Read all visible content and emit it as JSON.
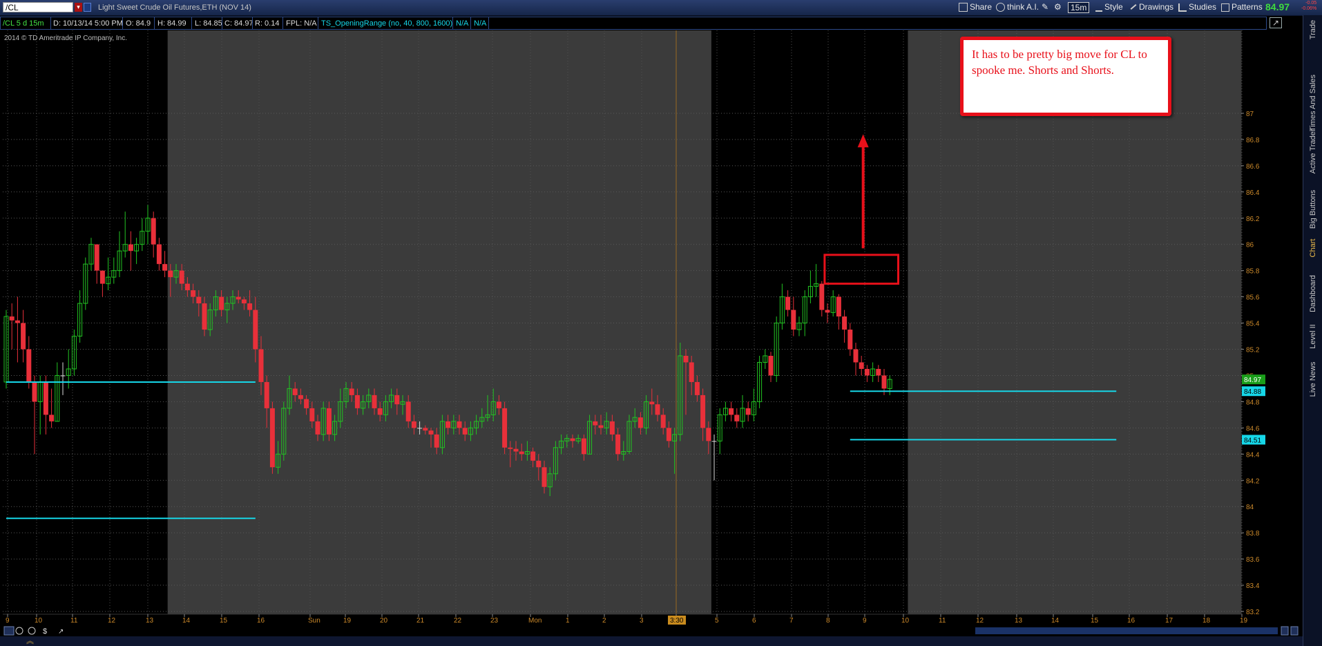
{
  "toolbar": {
    "symbol": "/CL",
    "description": "Light Sweet Crude Oil Futures,ETH (NOV 14)",
    "share_label": "Share",
    "think_ai_label": "think A.I.",
    "timeframe_label": "15m",
    "style_label": "Style",
    "drawings_label": "Drawings",
    "studies_label": "Studies",
    "patterns_label": "Patterns",
    "last_price": "84.97",
    "change_line1": "-0.05",
    "change_line2": "-0.06%"
  },
  "infobar": {
    "symbol_period": "/CL 5 d 15m",
    "date": "D: 10/13/14 5:00 PM",
    "open": "O: 84.9",
    "high": "H: 84.99",
    "low": "L: 84.85",
    "close": "C: 84.97",
    "range": "R: 0.14",
    "fpl": "FPL: N/A",
    "study": "TS_OpeningRange (no, 40, 800, 1600)",
    "na1": "N/A",
    "na2": "N/A"
  },
  "copyright": "2014 © TD Ameritrade IP Company, Inc.",
  "annotation": {
    "text": "It has to be pretty big move for CL to spooke me. Shorts and Shorts."
  },
  "right_panel_tabs": [
    "Trade",
    "Times And Sales",
    "Active Trader",
    "Big Buttons",
    "Chart",
    "Dashboard",
    "Level II",
    "Live News"
  ],
  "colors": {
    "up": "#22c422",
    "down": "#e8303a",
    "neutral": "#dddddd",
    "opening_range": "#16d7e8",
    "session_bg": "#3b3b3b",
    "axis_text": "#cd8a2a",
    "annotation": "#e8101a"
  },
  "chart_data": {
    "type": "candlestick",
    "ylim": [
      83.2,
      87.2
    ],
    "y_ticks": [
      "87",
      "86.8",
      "86.6",
      "86.4",
      "86.2",
      "86",
      "85.8",
      "85.6",
      "85.4",
      "85.2",
      "85",
      "84.8",
      "84.6",
      "84.4",
      "84.2",
      "84",
      "83.8",
      "83.6",
      "83.4",
      "83.2"
    ],
    "x_ticks": [
      "9",
      "10",
      "11",
      "12",
      "13",
      "14",
      "15",
      "16",
      "Sun",
      "19",
      "20",
      "21",
      "22",
      "23",
      "Mon",
      "1",
      "2",
      "3",
      "3:30",
      "5",
      "6",
      "7",
      "8",
      "9",
      "10",
      "11",
      "12",
      "13",
      "14",
      "15",
      "16",
      "17",
      "18",
      "19"
    ],
    "price_labels": [
      {
        "value": "84.97",
        "kind": "last"
      },
      {
        "value": "84.88",
        "kind": "opening_range_high"
      },
      {
        "value": "84.51",
        "kind": "opening_range_low"
      }
    ],
    "opening_range_lines": [
      {
        "y": 84.95,
        "from": 0,
        "to": 44
      },
      {
        "y": 83.91,
        "from": 0,
        "to": 44
      },
      {
        "y": 84.88,
        "from": 149,
        "to": 196
      },
      {
        "y": 84.51,
        "from": 149,
        "to": 196
      }
    ],
    "candles": [
      [
        84.95,
        85.45,
        85.5,
        84.9
      ],
      [
        85.45,
        85.42,
        85.55,
        85.2
      ],
      [
        85.42,
        85.4,
        85.6,
        85.1
      ],
      [
        85.4,
        85.2,
        85.5,
        85.1
      ],
      [
        85.2,
        84.95,
        85.3,
        84.9
      ],
      [
        84.95,
        84.8,
        85.0,
        84.4
      ],
      [
        84.8,
        84.95,
        85.0,
        84.55
      ],
      [
        84.95,
        84.7,
        85.0,
        84.55
      ],
      [
        84.7,
        84.65,
        84.9,
        84.6
      ],
      [
        84.65,
        85.0,
        85.1,
        84.65
      ],
      [
        85.0,
        85.0,
        85.1,
        84.85
      ],
      [
        85.0,
        85.05,
        85.2,
        84.9
      ],
      [
        85.05,
        85.3,
        85.35,
        85.0
      ],
      [
        85.3,
        85.55,
        85.65,
        85.25
      ],
      [
        85.55,
        85.85,
        85.9,
        85.5
      ],
      [
        85.85,
        86.0,
        86.05,
        85.8
      ],
      [
        86.0,
        85.8,
        86.0,
        85.7
      ],
      [
        85.8,
        85.7,
        85.8,
        85.6
      ],
      [
        85.7,
        85.75,
        85.9,
        85.65
      ],
      [
        85.75,
        85.8,
        85.9,
        85.7
      ],
      [
        85.8,
        85.95,
        86.1,
        85.75
      ],
      [
        85.95,
        86.0,
        86.25,
        85.9
      ],
      [
        86.0,
        85.95,
        86.1,
        85.8
      ],
      [
        85.95,
        86.0,
        86.05,
        85.85
      ],
      [
        86.0,
        86.1,
        86.2,
        85.95
      ],
      [
        86.1,
        86.2,
        86.3,
        86.0
      ],
      [
        86.2,
        86.0,
        86.25,
        85.9
      ],
      [
        86.0,
        85.85,
        86.05,
        85.8
      ],
      [
        85.85,
        85.8,
        85.95,
        85.75
      ],
      [
        85.8,
        85.75,
        85.85,
        85.6
      ],
      [
        85.75,
        85.8,
        85.85,
        85.7
      ],
      [
        85.8,
        85.7,
        85.85,
        85.65
      ],
      [
        85.7,
        85.65,
        85.75,
        85.6
      ],
      [
        85.65,
        85.6,
        85.7,
        85.55
      ],
      [
        85.6,
        85.55,
        85.65,
        85.45
      ],
      [
        85.55,
        85.35,
        85.6,
        85.3
      ],
      [
        85.35,
        85.5,
        85.55,
        85.3
      ],
      [
        85.5,
        85.6,
        85.65,
        85.45
      ],
      [
        85.6,
        85.5,
        85.65,
        85.45
      ],
      [
        85.5,
        85.55,
        85.6,
        85.4
      ],
      [
        85.55,
        85.6,
        85.65,
        85.5
      ],
      [
        85.6,
        85.58,
        85.65,
        85.55
      ],
      [
        85.58,
        85.55,
        85.6,
        85.5
      ],
      [
        85.55,
        85.5,
        85.65,
        85.45
      ],
      [
        85.5,
        85.2,
        85.6,
        85.1
      ],
      [
        85.2,
        84.95,
        85.3,
        84.85
      ],
      [
        84.95,
        84.75,
        85.0,
        84.6
      ],
      [
        84.75,
        84.3,
        84.8,
        84.25
      ],
      [
        84.3,
        84.4,
        84.5,
        84.25
      ],
      [
        84.4,
        84.75,
        84.8,
        84.35
      ],
      [
        84.75,
        84.9,
        85.0,
        84.7
      ],
      [
        84.9,
        84.85,
        84.95,
        84.8
      ],
      [
        84.85,
        84.82,
        84.9,
        84.78
      ],
      [
        84.82,
        84.75,
        84.85,
        84.7
      ],
      [
        84.75,
        84.65,
        84.8,
        84.6
      ],
      [
        84.65,
        84.55,
        84.7,
        84.5
      ],
      [
        84.55,
        84.75,
        84.8,
        84.5
      ],
      [
        84.75,
        84.55,
        84.8,
        84.5
      ],
      [
        84.55,
        84.65,
        84.7,
        84.5
      ],
      [
        84.65,
        84.8,
        84.9,
        84.6
      ],
      [
        84.8,
        84.9,
        84.95,
        84.75
      ],
      [
        84.9,
        84.85,
        84.95,
        84.8
      ],
      [
        84.85,
        84.75,
        84.9,
        84.7
      ],
      [
        84.75,
        84.8,
        84.85,
        84.7
      ],
      [
        84.8,
        84.85,
        84.9,
        84.75
      ],
      [
        84.85,
        84.75,
        84.9,
        84.7
      ],
      [
        84.75,
        84.7,
        84.8,
        84.65
      ],
      [
        84.7,
        84.8,
        84.85,
        84.65
      ],
      [
        84.8,
        84.85,
        84.9,
        84.75
      ],
      [
        84.85,
        84.78,
        84.9,
        84.7
      ],
      [
        84.78,
        84.8,
        84.85,
        84.7
      ],
      [
        84.8,
        84.65,
        84.85,
        84.6
      ],
      [
        84.65,
        84.6,
        84.7,
        84.55
      ],
      [
        84.6,
        84.6,
        84.65,
        84.55
      ],
      [
        84.6,
        84.58,
        84.62,
        84.55
      ],
      [
        84.58,
        84.55,
        84.6,
        84.45
      ],
      [
        84.55,
        84.45,
        84.6,
        84.4
      ],
      [
        84.45,
        84.65,
        84.7,
        84.4
      ],
      [
        84.65,
        84.6,
        84.7,
        84.55
      ],
      [
        84.6,
        84.65,
        84.7,
        84.55
      ],
      [
        84.65,
        84.6,
        84.7,
        84.55
      ],
      [
        84.6,
        84.55,
        84.65,
        84.5
      ],
      [
        84.55,
        84.6,
        84.65,
        84.5
      ],
      [
        84.6,
        84.65,
        84.7,
        84.55
      ],
      [
        84.65,
        84.68,
        84.75,
        84.6
      ],
      [
        84.68,
        84.7,
        84.85,
        84.65
      ],
      [
        84.7,
        84.8,
        84.9,
        84.65
      ],
      [
        84.8,
        84.75,
        84.85,
        84.7
      ],
      [
        84.75,
        84.45,
        84.8,
        84.4
      ],
      [
        84.45,
        84.44,
        84.5,
        84.3
      ],
      [
        84.44,
        84.42,
        84.5,
        84.35
      ],
      [
        84.42,
        84.4,
        84.48,
        84.35
      ],
      [
        84.4,
        84.42,
        84.5,
        84.35
      ],
      [
        84.42,
        84.35,
        84.45,
        84.3
      ],
      [
        84.35,
        84.3,
        84.4,
        84.2
      ],
      [
        84.3,
        84.15,
        84.35,
        84.1
      ],
      [
        84.15,
        84.25,
        84.3,
        84.08
      ],
      [
        84.25,
        84.45,
        84.5,
        84.2
      ],
      [
        84.45,
        84.5,
        84.55,
        84.4
      ],
      [
        84.5,
        84.52,
        84.55,
        84.45
      ],
      [
        84.52,
        84.5,
        84.55,
        84.45
      ],
      [
        84.5,
        84.52,
        84.55,
        84.48
      ],
      [
        84.52,
        84.4,
        84.55,
        84.35
      ],
      [
        84.4,
        84.65,
        84.7,
        84.4
      ],
      [
        84.65,
        84.62,
        84.7,
        84.55
      ],
      [
        84.62,
        84.6,
        84.7,
        84.55
      ],
      [
        84.6,
        84.65,
        84.72,
        84.55
      ],
      [
        84.65,
        84.55,
        84.7,
        84.5
      ],
      [
        84.55,
        84.4,
        84.6,
        84.35
      ],
      [
        84.4,
        84.42,
        84.5,
        84.35
      ],
      [
        84.42,
        84.65,
        84.7,
        84.4
      ],
      [
        84.65,
        84.68,
        84.75,
        84.6
      ],
      [
        84.68,
        84.6,
        84.72,
        84.55
      ],
      [
        84.6,
        84.8,
        84.85,
        84.55
      ],
      [
        84.8,
        84.78,
        84.9,
        84.7
      ],
      [
        84.78,
        84.7,
        84.85,
        84.65
      ],
      [
        84.7,
        84.6,
        84.75,
        84.55
      ],
      [
        84.6,
        84.5,
        84.65,
        84.45
      ],
      [
        84.5,
        84.55,
        84.6,
        84.25
      ],
      [
        84.55,
        85.15,
        85.25,
        84.5
      ],
      [
        85.15,
        85.1,
        85.2,
        84.7
      ],
      [
        85.1,
        84.95,
        85.15,
        84.85
      ],
      [
        84.95,
        84.85,
        85.0,
        84.8
      ],
      [
        84.85,
        84.6,
        84.9,
        84.5
      ],
      [
        84.6,
        84.5,
        84.65,
        84.4
      ],
      [
        84.5,
        84.5,
        84.55,
        84.2
      ],
      [
        84.5,
        84.7,
        84.75,
        84.4
      ],
      [
        84.7,
        84.75,
        84.8,
        84.65
      ],
      [
        84.75,
        84.7,
        84.8,
        84.65
      ],
      [
        84.7,
        84.65,
        84.75,
        84.6
      ],
      [
        84.65,
        84.75,
        84.85,
        84.6
      ],
      [
        84.75,
        84.7,
        84.8,
        84.65
      ],
      [
        84.7,
        84.8,
        84.9,
        84.65
      ],
      [
        84.8,
        85.1,
        85.15,
        84.75
      ],
      [
        85.1,
        85.15,
        85.2,
        85.05
      ],
      [
        85.15,
        85.0,
        85.18,
        84.95
      ],
      [
        85.0,
        85.4,
        85.45,
        84.95
      ],
      [
        85.4,
        85.6,
        85.7,
        85.35
      ],
      [
        85.6,
        85.5,
        85.65,
        85.45
      ],
      [
        85.5,
        85.35,
        85.6,
        85.3
      ],
      [
        85.35,
        85.4,
        85.45,
        85.3
      ],
      [
        85.4,
        85.6,
        85.65,
        85.3
      ],
      [
        85.6,
        85.68,
        85.8,
        85.55
      ],
      [
        85.68,
        85.7,
        85.85,
        85.6
      ],
      [
        85.7,
        85.5,
        85.72,
        85.45
      ],
      [
        85.5,
        85.48,
        85.55,
        85.4
      ],
      [
        85.48,
        85.6,
        85.65,
        85.45
      ],
      [
        85.6,
        85.45,
        85.62,
        85.35
      ],
      [
        85.45,
        85.35,
        85.5,
        85.25
      ],
      [
        85.35,
        85.2,
        85.4,
        85.15
      ],
      [
        85.2,
        85.1,
        85.25,
        85.0
      ],
      [
        85.1,
        85.05,
        85.15,
        85.0
      ],
      [
        85.05,
        85.0,
        85.08,
        84.95
      ],
      [
        85.0,
        85.05,
        85.1,
        84.95
      ],
      [
        85.05,
        85.0,
        85.08,
        84.95
      ],
      [
        85.0,
        84.9,
        85.05,
        84.85
      ],
      [
        84.9,
        84.97,
        85.0,
        84.85
      ]
    ]
  }
}
